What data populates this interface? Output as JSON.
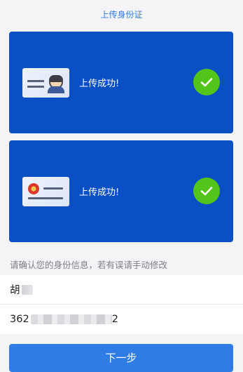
{
  "header": {
    "title": "上传身份证"
  },
  "cards": [
    {
      "side": "front",
      "status": "上传成功!",
      "icon": "id-card-front-icon"
    },
    {
      "side": "back",
      "status": "上传成功!",
      "icon": "id-card-back-icon"
    }
  ],
  "form": {
    "hint": "请确认您的身份信息，若有误请手动修改",
    "name_prefix": "胡",
    "id_prefix": "362",
    "id_suffix": "2"
  },
  "footer": {
    "next_label": "下一步"
  },
  "colors": {
    "card_bg": "#0a4fc4",
    "accent": "#2f7ce6",
    "success": "#52c41a"
  }
}
